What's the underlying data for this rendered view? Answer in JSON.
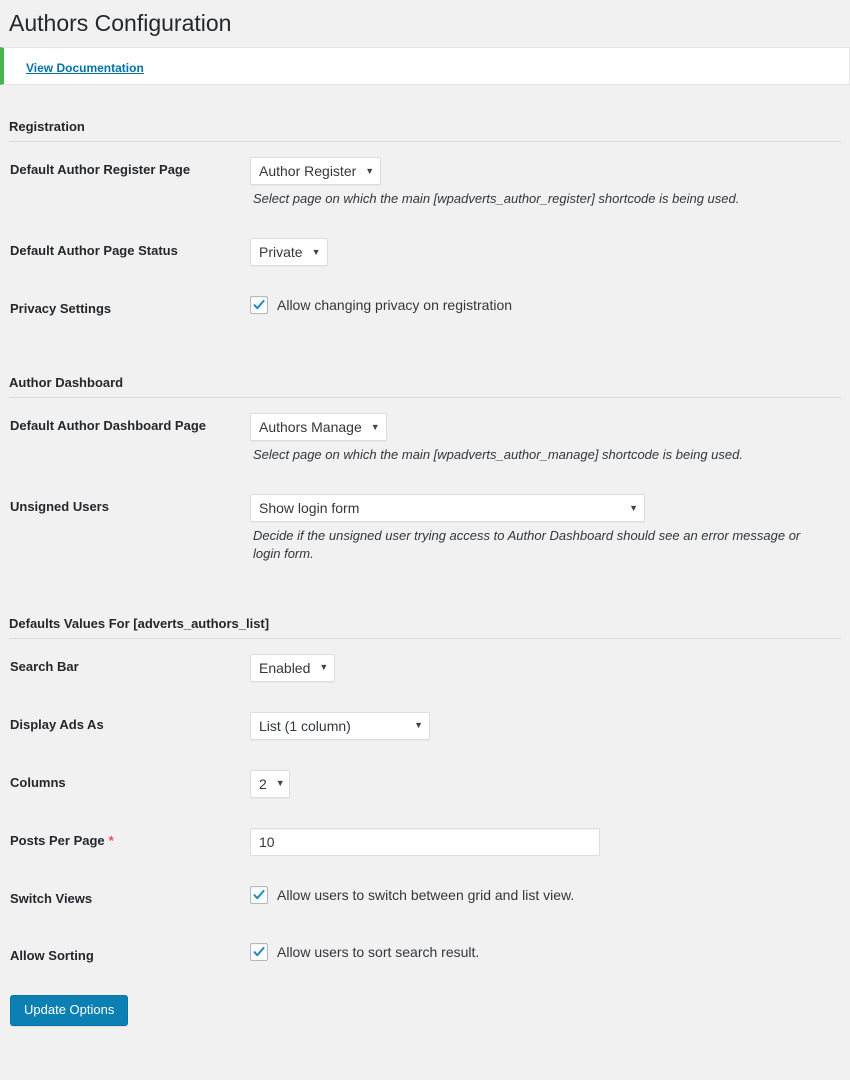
{
  "page": {
    "title": "Authors Configuration",
    "notice_link": "View Documentation",
    "accent_green": "#46b450",
    "accent_blue": "#0073aa",
    "required_color": "#e05252"
  },
  "sections": [
    {
      "heading": "Registration",
      "fields": [
        {
          "label": "Default Author Register Page",
          "type": "select",
          "value": "Author Register",
          "description": "Select page on which the main [wpadverts_author_register] shortcode is being used."
        },
        {
          "label": "Default Author Page Status",
          "type": "select",
          "value": "Private",
          "description": ""
        },
        {
          "label": "Privacy Settings",
          "type": "checkbox",
          "checked": true,
          "checkbox_label": "Allow changing privacy on registration",
          "description": ""
        }
      ]
    },
    {
      "heading": "Author Dashboard",
      "fields": [
        {
          "label": "Default Author Dashboard Page",
          "type": "select",
          "value": "Authors Manage",
          "description": "Select page on which the main [wpadverts_author_manage] shortcode is being used."
        },
        {
          "label": "Unsigned Users",
          "type": "select",
          "value": "Show login form",
          "description": "Decide if the unsigned user trying access to Author Dashboard should see an error message or login form."
        }
      ]
    },
    {
      "heading": "Defaults Values For [adverts_authors_list]",
      "fields": [
        {
          "label": "Search Bar",
          "type": "select",
          "value": "Enabled",
          "description": ""
        },
        {
          "label": "Display Ads As",
          "type": "select",
          "value": "List (1 column)",
          "description": ""
        },
        {
          "label": "Columns",
          "type": "select",
          "value": "2",
          "description": ""
        },
        {
          "label": "Posts Per Page",
          "required_marker": "*",
          "type": "text",
          "value": "10",
          "description": ""
        },
        {
          "label": "Switch Views",
          "type": "checkbox",
          "checked": true,
          "checkbox_label": "Allow users to switch between grid and list view.",
          "description": ""
        },
        {
          "label": "Allow Sorting",
          "type": "checkbox",
          "checked": true,
          "checkbox_label": "Allow users to sort search result.",
          "description": ""
        }
      ]
    }
  ],
  "submit": {
    "label": "Update Options"
  },
  "icons": {
    "dropdown_arrow": "▼",
    "checkmark": "check-icon"
  }
}
